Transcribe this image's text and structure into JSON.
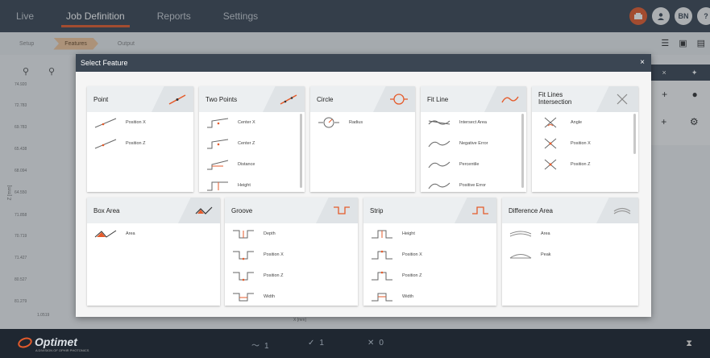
{
  "topbar": {
    "tabs": [
      "Live",
      "Job Definition",
      "Reports",
      "Settings"
    ],
    "active_index": 1,
    "user_initials": "BN"
  },
  "steps": [
    "Setup",
    "Features",
    "Output"
  ],
  "chart": {
    "y_ticks": [
      "74.920",
      "72.783",
      "69.783",
      "65.438",
      "68.094",
      "64.550",
      "71.858",
      "70.719",
      "71.427",
      "80.527",
      "81.279"
    ],
    "y_label": "Z [mm]",
    "x_label": "X [mm]",
    "x_tick": "1.0519"
  },
  "right_panel": {
    "header_close": "×",
    "header_pin": "✦",
    "row1_add": "+",
    "row2_add": "+"
  },
  "bottom": {
    "brand": "Optimet",
    "brand_sub": "A DIVISION OF OPHIR PHOTONICS",
    "stat_line": "1",
    "stat_check": "1",
    "stat_cross": "0"
  },
  "modal": {
    "title": "Select Feature",
    "close": "×",
    "cards": [
      {
        "title": "Point",
        "icon": "point-icon",
        "items": [
          {
            "label": "Position X",
            "icon": "point-x-icon"
          },
          {
            "label": "Position Z",
            "icon": "point-z-icon"
          }
        ]
      },
      {
        "title": "Two Points",
        "icon": "two-points-icon",
        "items": [
          {
            "label": "Center X",
            "icon": "two-points-center-x-icon"
          },
          {
            "label": "Center Z",
            "icon": "two-points-center-z-icon"
          },
          {
            "label": "Distance",
            "icon": "distance-icon"
          },
          {
            "label": "Height",
            "icon": "height-icon"
          }
        ]
      },
      {
        "title": "Circle",
        "icon": "circle-icon",
        "items": [
          {
            "label": "Radius",
            "icon": "radius-icon"
          }
        ]
      },
      {
        "title": "Fit Line",
        "icon": "fit-line-icon",
        "items": [
          {
            "label": "Intersect Area",
            "icon": "intersect-area-icon"
          },
          {
            "label": "Negative Error",
            "icon": "negative-error-icon"
          },
          {
            "label": "Percentile",
            "icon": "percentile-icon"
          },
          {
            "label": "Positive Error",
            "icon": "positive-error-icon"
          }
        ]
      },
      {
        "title": "Fit Lines Intersection",
        "icon": "fit-lines-intersection-icon",
        "items": [
          {
            "label": "Angle",
            "icon": "angle-icon"
          },
          {
            "label": "Position X",
            "icon": "intersection-x-icon"
          },
          {
            "label": "Position Z",
            "icon": "intersection-z-icon"
          }
        ]
      },
      {
        "title": "Box Area",
        "icon": "box-area-icon",
        "items": [
          {
            "label": "Area",
            "icon": "box-area-item-icon"
          }
        ]
      },
      {
        "title": "Groove",
        "icon": "groove-icon",
        "items": [
          {
            "label": "Depth",
            "icon": "groove-depth-icon"
          },
          {
            "label": "Position X",
            "icon": "groove-x-icon"
          },
          {
            "label": "Position Z",
            "icon": "groove-z-icon"
          },
          {
            "label": "Width",
            "icon": "groove-width-icon"
          }
        ]
      },
      {
        "title": "Strip",
        "icon": "strip-icon",
        "items": [
          {
            "label": "Height",
            "icon": "strip-height-icon"
          },
          {
            "label": "Position X",
            "icon": "strip-x-icon"
          },
          {
            "label": "Position Z",
            "icon": "strip-z-icon"
          },
          {
            "label": "Width",
            "icon": "strip-width-icon"
          }
        ]
      },
      {
        "title": "Difference Area",
        "icon": "difference-area-icon",
        "items": [
          {
            "label": "Area",
            "icon": "diff-area-icon"
          },
          {
            "label": "Peak",
            "icon": "diff-peak-icon"
          }
        ]
      }
    ]
  },
  "colors": {
    "accent": "#e55b2b",
    "topbar": "#3b4653",
    "bottombar": "#1f2731"
  }
}
